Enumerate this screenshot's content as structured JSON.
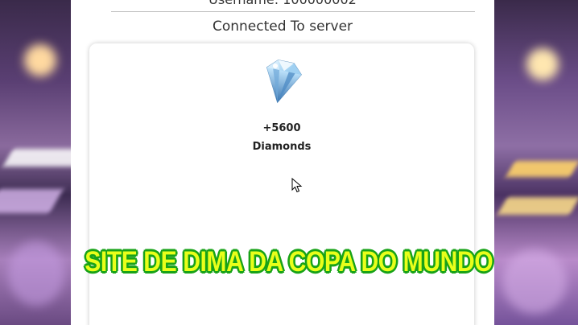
{
  "header": {
    "username_text": "Username: 100000002",
    "connection_status": "Connected To server"
  },
  "reward": {
    "icon": "diamond-icon",
    "amount": "+5600",
    "unit": "Diamonds"
  },
  "overlay": {
    "caption": "SITE DE DIMA DA COPA DO MUNDO",
    "caption_color": "#e9ff1a",
    "caption_outline_color": "#19a319"
  }
}
